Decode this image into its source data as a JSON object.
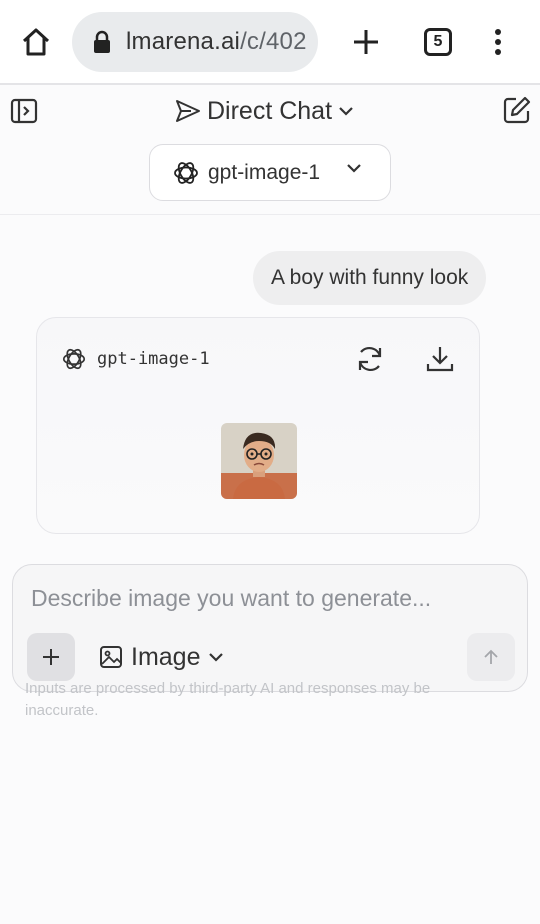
{
  "browser": {
    "url_host": "lmarena.ai",
    "url_path": "/c/402",
    "tab_count": "5"
  },
  "header": {
    "mode_label": "Direct Chat",
    "model_label": "gpt-image-1"
  },
  "chat": {
    "user_message": "A boy with funny look",
    "response": {
      "model_label": "gpt-image-1"
    }
  },
  "composer": {
    "placeholder": "Describe image you want to generate...",
    "mode_label": "Image",
    "disclaimer": "Inputs are processed by third-party AI and responses may be inaccurate."
  },
  "icons": {
    "home": "home-icon",
    "lock": "lock-icon",
    "new_tab": "plus-icon",
    "menu": "kebab-menu-icon",
    "sidebar": "sidebar-toggle-icon",
    "new_chat": "edit-icon",
    "mode": "send-icon",
    "model": "openai-logo-icon",
    "regenerate": "refresh-icon",
    "download": "download-icon",
    "attach": "plus-icon",
    "image": "image-icon",
    "send": "arrow-up-icon"
  }
}
